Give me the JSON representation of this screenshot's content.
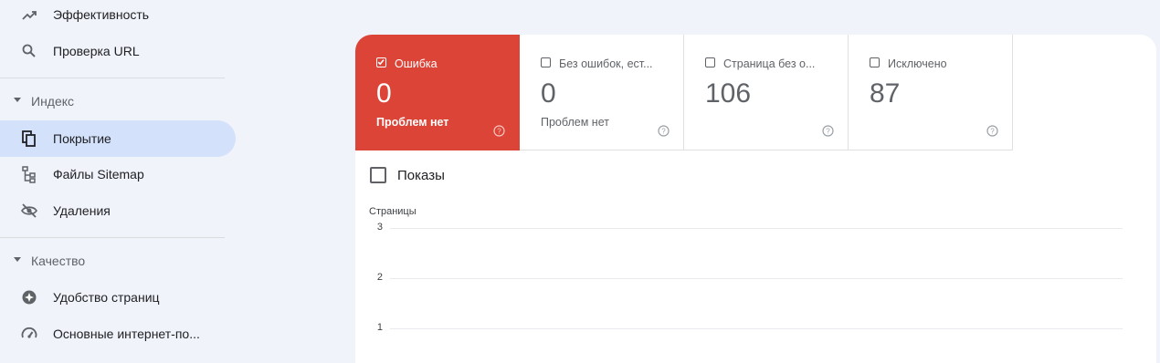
{
  "sidebar": {
    "items": [
      {
        "label": "Эффективность",
        "icon": "trending-up-icon"
      },
      {
        "label": "Проверка URL",
        "icon": "search-icon"
      },
      {
        "label": "Покрытие",
        "icon": "file-copy-icon",
        "active": true
      },
      {
        "label": "Файлы Sitemap",
        "icon": "sitemap-icon"
      },
      {
        "label": "Удаления",
        "icon": "visibility-off-icon"
      },
      {
        "label": "Удобство страниц",
        "icon": "page-experience-icon"
      },
      {
        "label": "Основные интернет-по...",
        "icon": "speed-gauge-icon"
      }
    ],
    "sections": [
      {
        "label": "Индекс"
      },
      {
        "label": "Качество"
      }
    ]
  },
  "tiles": [
    {
      "name": "Ошибка",
      "value": "0",
      "sub": "Проблем нет",
      "checked": true,
      "color": "#db4437"
    },
    {
      "name": "Без ошибок, ест...",
      "value": "0",
      "sub": "Проблем нет",
      "checked": false
    },
    {
      "name": "Страница без о...",
      "value": "106",
      "sub": "",
      "checked": false
    },
    {
      "name": "Исключено",
      "value": "87",
      "sub": "",
      "checked": false
    }
  ],
  "impressions": {
    "label": "Показы",
    "checked": false
  },
  "chart_data": {
    "type": "line",
    "ylabel": "Страницы",
    "yticks": [
      "3",
      "2",
      "1"
    ],
    "series": []
  }
}
